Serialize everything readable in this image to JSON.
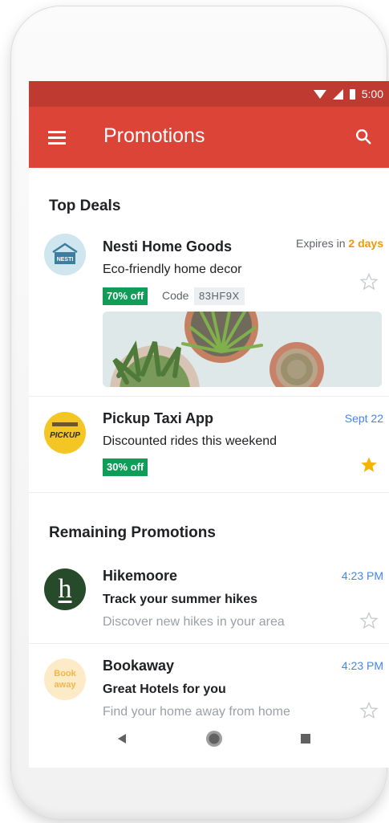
{
  "status_bar": {
    "time": "5:00"
  },
  "app_bar": {
    "title": "Promotions"
  },
  "top_deals": {
    "heading": "Top Deals",
    "items": [
      {
        "sender": "Nesti Home Goods",
        "avatar_text": "NESTI",
        "subject": "Eco-friendly home decor",
        "expires_prefix": "Expires in",
        "expires_value": "2 days",
        "discount": "70% off",
        "code_label": "Code",
        "code": "83HF9X",
        "starred": false
      },
      {
        "sender": "Pickup Taxi App",
        "avatar_text": "PICKUP",
        "subject": "Discounted rides this weekend",
        "date": "Sept 22",
        "discount": "30% off",
        "starred": true
      }
    ]
  },
  "remaining": {
    "heading": "Remaining Promotions",
    "items": [
      {
        "sender": "Hikemoore",
        "avatar_text": "h",
        "subject": "Track your summer hikes",
        "snippet": "Discover new hikes in your area",
        "time": "4:23 PM",
        "starred": false
      },
      {
        "sender": "Bookaway",
        "avatar_line1": "Book",
        "avatar_line2": "away",
        "subject": "Great Hotels for you",
        "snippet": "Find your home away from home",
        "time": "4:23 PM",
        "starred": false
      }
    ]
  },
  "colors": {
    "status_bar": "#bf3a30",
    "app_bar": "#db4437",
    "discount_green": "#109d58",
    "expiry_orange": "#f29900",
    "date_blue": "#4285f4",
    "star_gold": "#f4b400"
  }
}
